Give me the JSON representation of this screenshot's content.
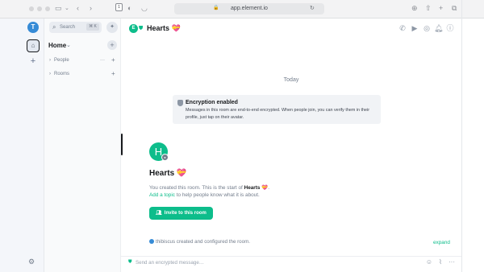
{
  "browser": {
    "url": "app.element.io",
    "tab_badge": "1"
  },
  "user": {
    "avatar_initial": "T"
  },
  "sidebar": {
    "search_placeholder": "Search",
    "search_shortcut": "⌘ K",
    "home_label": "Home",
    "sections": [
      {
        "label": "People"
      },
      {
        "label": "Rooms"
      }
    ]
  },
  "room": {
    "avatar_initial": "E",
    "name": "Hearts 💝",
    "big_avatar_initial": "H"
  },
  "timeline": {
    "date_separator": "Today",
    "encryption_title": "Encryption enabled",
    "encryption_body": "Messages in this room are end-to-end encrypted. When people join, you can verify them in their profile, just tap on their avatar.",
    "intro_title": "Hearts 💝",
    "created_prefix": "You created this room. This is the start of ",
    "created_room": "Hearts 💝",
    "created_suffix": ".",
    "topic_link": "Add a topic",
    "topic_suffix": " to help people know what it is about.",
    "invite_label": "Invite to this room",
    "configured_text": "thibiscus created and configured the room.",
    "expand_label": "expand"
  },
  "composer": {
    "placeholder": "Send an encrypted message…"
  },
  "colors": {
    "accent": "#0dbd8b",
    "avatar_user": "#368bd6",
    "text_primary": "#17191c",
    "text_secondary": "#737d8c"
  }
}
